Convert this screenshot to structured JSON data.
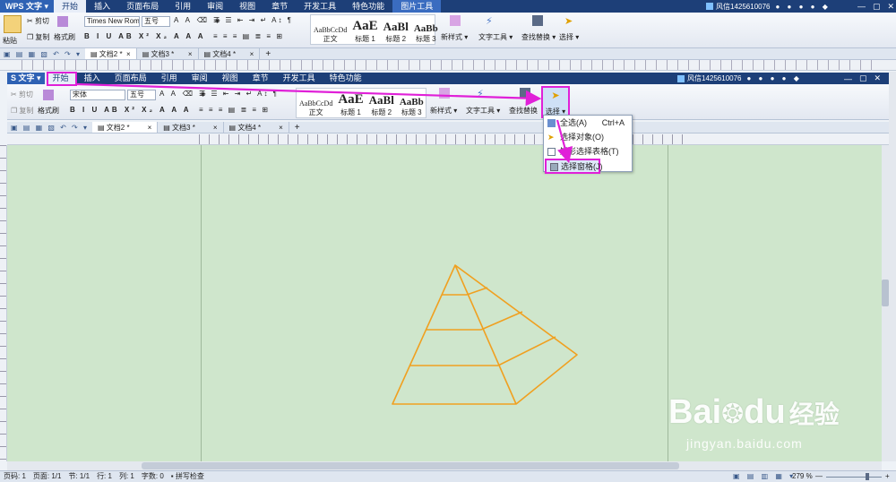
{
  "outer": {
    "app_name": "WPS 文字",
    "tabs": [
      "开始",
      "插入",
      "页面布局",
      "引用",
      "审阅",
      "视图",
      "章节",
      "开发工具",
      "特色功能"
    ],
    "picture_tools": "图片工具",
    "user": "风信1425610076",
    "font_name": "Times New Roman",
    "font_size": "五号",
    "paste": "粘贴",
    "cut": "剪切",
    "copy": "复制",
    "format_painter": "格式刷",
    "styles": [
      {
        "preview": "AaBbCcDd",
        "label": "正文"
      },
      {
        "preview": "AaE",
        "label": "标题 1"
      },
      {
        "preview": "AaBl",
        "label": "标题 2"
      },
      {
        "preview": "AaBb",
        "label": "标题 3"
      }
    ],
    "new_style": "新样式",
    "text_tools": "文字工具",
    "find_replace": "查找替换",
    "select": "选择",
    "doc_tabs": [
      "文档2 *",
      "文档3 *",
      "文档4 *"
    ]
  },
  "inner": {
    "app_name": "S 文字",
    "tabs": [
      "开始",
      "插入",
      "页面布局",
      "引用",
      "审阅",
      "视图",
      "章节",
      "开发工具",
      "特色功能"
    ],
    "user": "风信1425610076",
    "font_name": "宋体",
    "font_size": "五号",
    "cut": "剪切",
    "copy": "复制",
    "format_painter": "格式刷",
    "styles": [
      {
        "preview": "AaBbCcDd",
        "label": "正文"
      },
      {
        "preview": "AaE",
        "label": "标题 1"
      },
      {
        "preview": "AaBl",
        "label": "标题 2"
      },
      {
        "preview": "AaBb",
        "label": "标题 3"
      }
    ],
    "new_style": "新样式",
    "text_tools": "文字工具",
    "find_replace": "查找替换",
    "select": "选择",
    "doc_tabs": [
      "文档2 *",
      "文档3 *",
      "文档4 *"
    ]
  },
  "dropdown": {
    "items": [
      {
        "label": "全选(A)",
        "shortcut": "Ctrl+A"
      },
      {
        "label": "选择对象(O)",
        "shortcut": ""
      },
      {
        "label": "矩形选择表格(T)",
        "shortcut": ""
      },
      {
        "label": "选择窗格(J)",
        "shortcut": ""
      }
    ]
  },
  "status": {
    "page_num": "页码: 1",
    "pages": "页面: 1/1",
    "section": "节: 1/1",
    "row": "行: 1",
    "col": "列: 1",
    "words": "字数: 0",
    "spellcheck": "拼写检查",
    "zoom": "279 %"
  },
  "watermark": {
    "brand_a": "Bai",
    "brand_b": "du",
    "brand_c": "经验",
    "url": "jingyan.baidu.com"
  },
  "colors": {
    "accent": "#e020d8",
    "shape": "#f0a020",
    "page_bg": "#cfe6cc",
    "title_bar": "#1d3f78"
  }
}
